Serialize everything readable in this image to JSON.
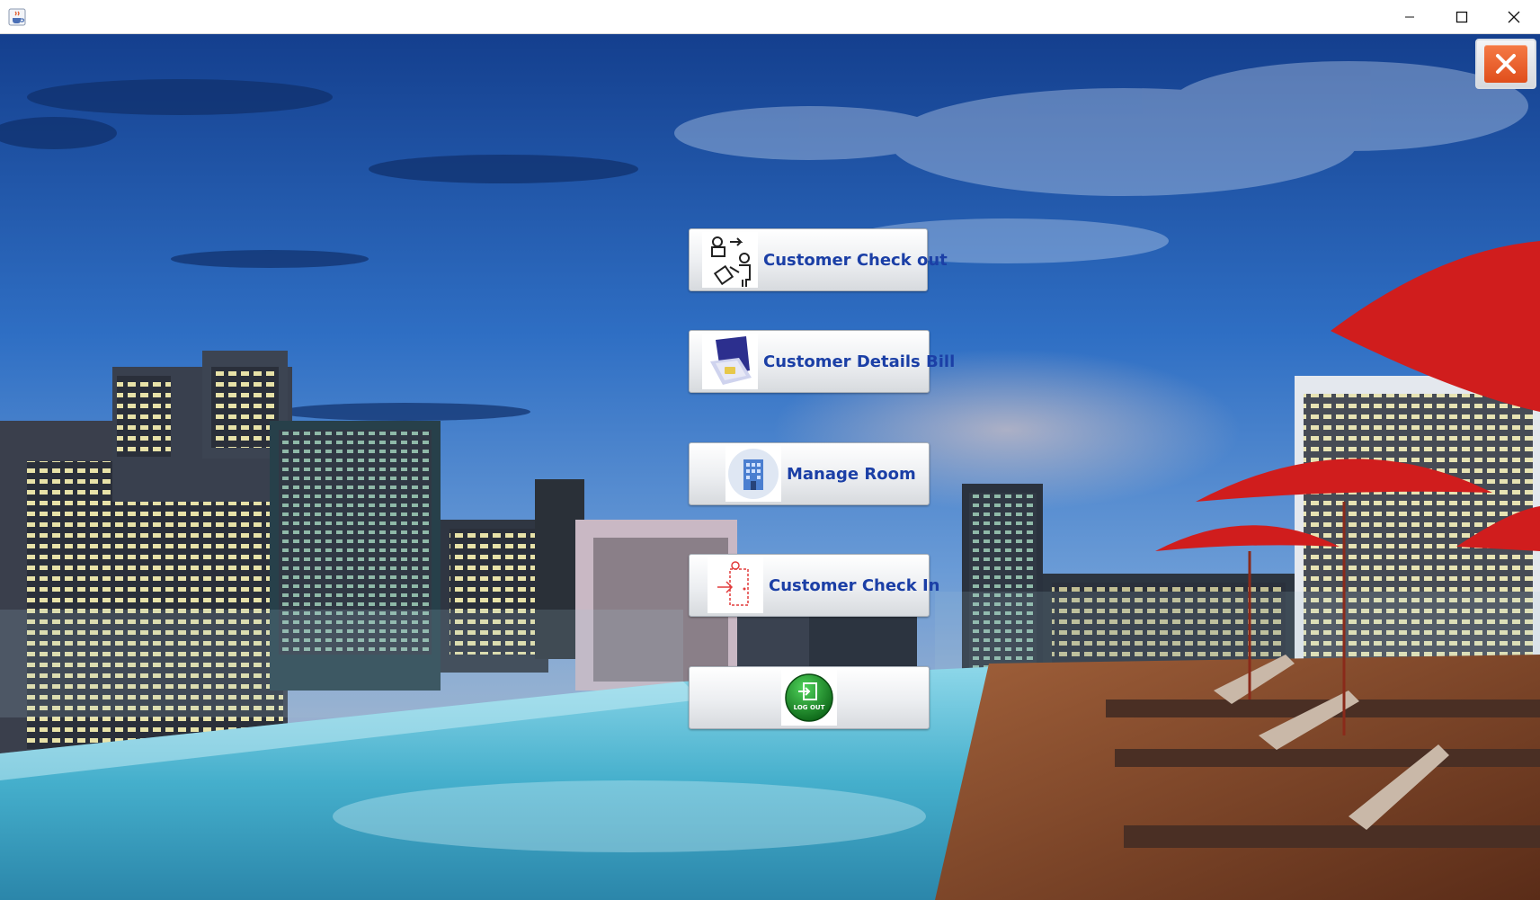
{
  "window": {
    "app_icon": "java-cup-icon",
    "controls": [
      "minimize-icon",
      "maximize-icon",
      "close-icon"
    ]
  },
  "background": {
    "image": "rooftop-pool-city-skyline",
    "colors": {
      "sky_top": "#1f4fa3",
      "sky_mid": "#3f7fd0",
      "pool": "#4db4cf",
      "umbrella": "#d61f1f",
      "deck": "#7a3f22"
    }
  },
  "exit_button": {
    "icon": "x-icon",
    "color": "#ea5a24"
  },
  "menu": {
    "checkout_label": "Customer Check out",
    "checkout_icon": "luggage-checkout-icon",
    "bill_label": "Customer Details Bill",
    "bill_icon": "bill-icon",
    "manage_room_label": "Manage Room",
    "manage_room_icon": "building-icon",
    "checkin_label": "Customer Check In",
    "checkin_icon": "door-checkin-icon",
    "logout_icon_text": "LOG OUT",
    "logout_icon": "logout-icon",
    "label_color": "#1b3fa6"
  }
}
